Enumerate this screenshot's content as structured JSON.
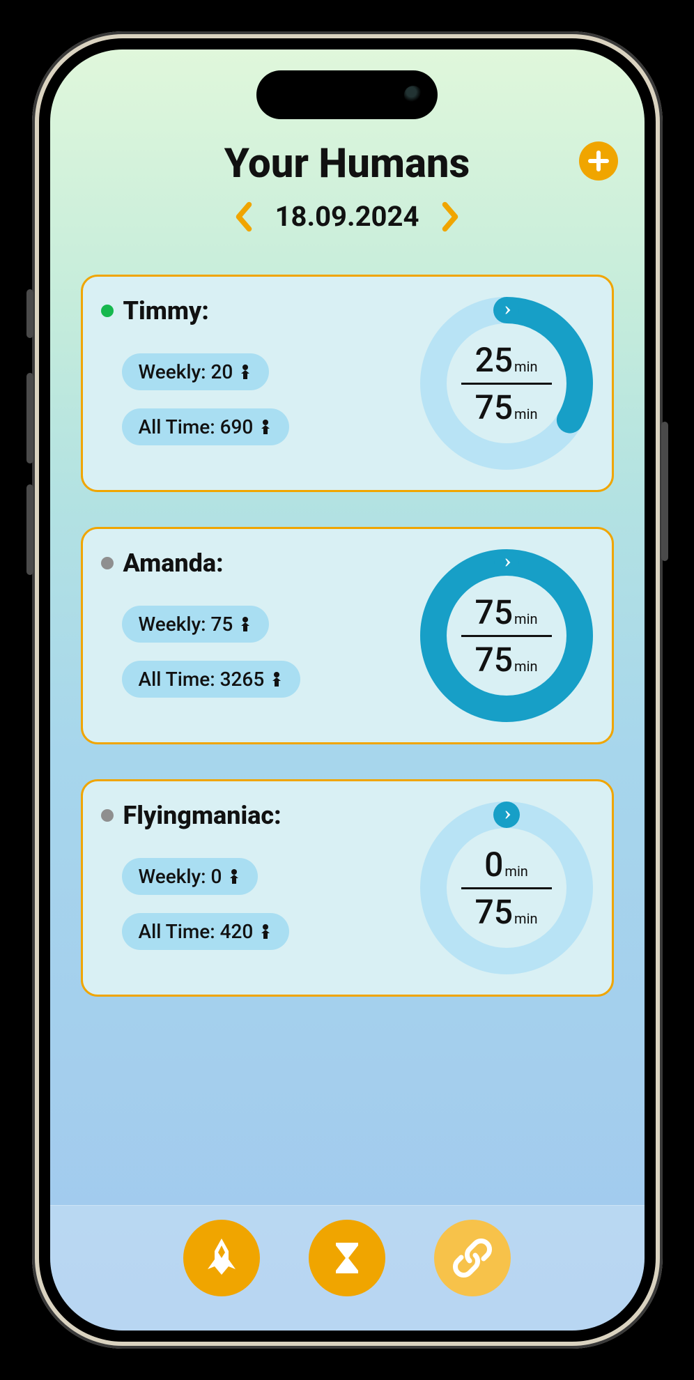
{
  "colors": {
    "accent": "#f0a500",
    "ringTrack": "#b8e3f5",
    "ringProgress": "#179fc7",
    "pill": "#a9def2",
    "cardBg": "#d9f0f4",
    "online": "#16b84e",
    "offline": "#8f8f8f"
  },
  "header": {
    "title": "Your Humans",
    "date": "18.09.2024"
  },
  "labels": {
    "weeklyPrefix": "Weekly: ",
    "allTimePrefix": "All Time: ",
    "minUnit": "min"
  },
  "humans": [
    {
      "name": "Timmy:",
      "status": "online",
      "weekly": 20,
      "allTime": 690,
      "usedMin": 25,
      "totalMin": 75
    },
    {
      "name": "Amanda:",
      "status": "offline",
      "weekly": 75,
      "allTime": 3265,
      "usedMin": 75,
      "totalMin": 75
    },
    {
      "name": "Flyingmaniac:",
      "status": "offline",
      "weekly": 0,
      "allTime": 420,
      "usedMin": 0,
      "totalMin": 75
    }
  ],
  "nav": {
    "items": [
      "rocket",
      "hourglass",
      "link"
    ]
  }
}
